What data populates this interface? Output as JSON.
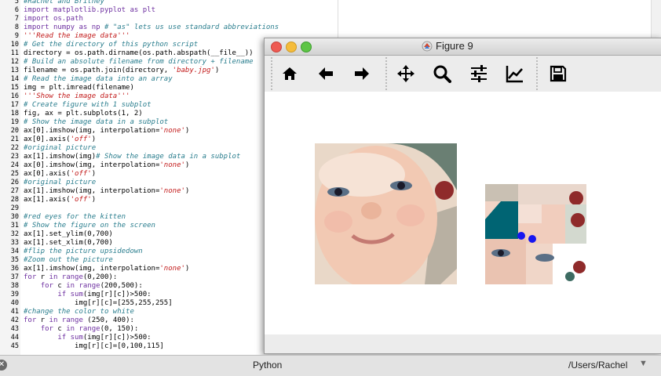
{
  "editor": {
    "lines": [
      {
        "n": "5",
        "segs": [
          [
            "c",
            "#Rachel and Britney"
          ]
        ]
      },
      {
        "n": "6",
        "segs": [
          [
            "k",
            "import"
          ],
          [
            "p",
            " "
          ],
          [
            "k",
            "matplotlib.pyplot"
          ],
          [
            "p",
            " "
          ],
          [
            "k",
            "as"
          ],
          [
            "p",
            " "
          ],
          [
            "k",
            "plt"
          ]
        ]
      },
      {
        "n": "7",
        "segs": [
          [
            "k",
            "import"
          ],
          [
            "p",
            " "
          ],
          [
            "k",
            "os.path"
          ]
        ]
      },
      {
        "n": "8",
        "segs": [
          [
            "k",
            "import"
          ],
          [
            "p",
            " "
          ],
          [
            "k",
            "numpy"
          ],
          [
            "p",
            " "
          ],
          [
            "k",
            "as"
          ],
          [
            "p",
            " "
          ],
          [
            "k",
            "np"
          ],
          [
            "p",
            " "
          ],
          [
            "c",
            "# \"as\" lets us use standard abbreviations"
          ]
        ]
      },
      {
        "n": "9",
        "segs": [
          [
            "s",
            "'''Read the image data'''"
          ]
        ]
      },
      {
        "n": "10",
        "segs": [
          [
            "c",
            "# Get the directory of this python script"
          ]
        ]
      },
      {
        "n": "11",
        "segs": [
          [
            "p",
            "directory = os.path.dirname(os.path.abspath(__file__))"
          ]
        ]
      },
      {
        "n": "12",
        "segs": [
          [
            "c",
            "# Build an absolute filename from directory + filename"
          ]
        ]
      },
      {
        "n": "13",
        "segs": [
          [
            "p",
            "filename = os.path.join(directory, "
          ],
          [
            "s",
            "'baby.jpg'"
          ],
          [
            "p",
            ")"
          ]
        ]
      },
      {
        "n": "14",
        "segs": [
          [
            "c",
            "# Read the image data into an array"
          ]
        ]
      },
      {
        "n": "15",
        "segs": [
          [
            "p",
            "img = plt.imread(filename)"
          ]
        ]
      },
      {
        "n": "16",
        "segs": [
          [
            "s",
            "'''Show the image data'''"
          ]
        ]
      },
      {
        "n": "17",
        "segs": [
          [
            "c",
            "# Create figure with 1 subplot"
          ]
        ]
      },
      {
        "n": "18",
        "segs": [
          [
            "p",
            "fig, ax = plt.subplots(1, 2)"
          ]
        ]
      },
      {
        "n": "19",
        "segs": [
          [
            "c",
            "# Show the image data in a subplot"
          ]
        ]
      },
      {
        "n": "20",
        "segs": [
          [
            "p",
            "ax[0].imshow(img, interpolation="
          ],
          [
            "s",
            "'none'"
          ],
          [
            "p",
            ")"
          ]
        ]
      },
      {
        "n": "21",
        "segs": [
          [
            "p",
            "ax[0].axis("
          ],
          [
            "s",
            "'off'"
          ],
          [
            "p",
            ")"
          ]
        ]
      },
      {
        "n": "22",
        "segs": [
          [
            "c",
            "#original picture"
          ]
        ]
      },
      {
        "n": "23",
        "segs": [
          [
            "p",
            "ax[1].imshow(img)"
          ],
          [
            "c",
            "# Show the image data in a subplot"
          ]
        ]
      },
      {
        "n": "24",
        "segs": [
          [
            "p",
            "ax[0].imshow(img, interpolation="
          ],
          [
            "s",
            "'none'"
          ],
          [
            "p",
            ")"
          ]
        ]
      },
      {
        "n": "25",
        "segs": [
          [
            "p",
            "ax[0].axis("
          ],
          [
            "s",
            "'off'"
          ],
          [
            "p",
            ")"
          ]
        ]
      },
      {
        "n": "26",
        "segs": [
          [
            "c",
            "#original picture"
          ]
        ]
      },
      {
        "n": "27",
        "segs": [
          [
            "p",
            "ax[1].imshow(img, interpolation="
          ],
          [
            "s",
            "'none'"
          ],
          [
            "p",
            ")"
          ]
        ]
      },
      {
        "n": "28",
        "segs": [
          [
            "p",
            "ax[1].axis("
          ],
          [
            "s",
            "'off'"
          ],
          [
            "p",
            ")"
          ]
        ]
      },
      {
        "n": "29",
        "segs": []
      },
      {
        "n": "30",
        "segs": [
          [
            "c",
            "#red eyes for the kitten"
          ]
        ]
      },
      {
        "n": "31",
        "segs": [
          [
            "c",
            "# Show the figure on the screen"
          ]
        ]
      },
      {
        "n": "32",
        "segs": [
          [
            "p",
            "ax[1].set_ylim(0,700)"
          ]
        ]
      },
      {
        "n": "33",
        "segs": [
          [
            "p",
            "ax[1].set_xlim(0,700)"
          ]
        ]
      },
      {
        "n": "34",
        "segs": [
          [
            "c",
            "#flip the picture upsidedown"
          ]
        ]
      },
      {
        "n": "35",
        "segs": [
          [
            "c",
            "#Zoom out the picture"
          ]
        ]
      },
      {
        "n": "36",
        "segs": [
          [
            "p",
            "ax[1].imshow(img, interpolation="
          ],
          [
            "s",
            "'none'"
          ],
          [
            "p",
            ")"
          ]
        ]
      },
      {
        "n": "37",
        "segs": [
          [
            "k",
            "for"
          ],
          [
            "p",
            " r "
          ],
          [
            "k",
            "in"
          ],
          [
            "p",
            " "
          ],
          [
            "k",
            "range"
          ],
          [
            "p",
            "(0,200):"
          ]
        ]
      },
      {
        "n": "38",
        "segs": [
          [
            "p",
            "    "
          ],
          [
            "k",
            "for"
          ],
          [
            "p",
            " c "
          ],
          [
            "k",
            "in"
          ],
          [
            "p",
            " "
          ],
          [
            "k",
            "range"
          ],
          [
            "p",
            "(200,500):"
          ]
        ]
      },
      {
        "n": "39",
        "segs": [
          [
            "p",
            "        "
          ],
          [
            "k",
            "if"
          ],
          [
            "p",
            " "
          ],
          [
            "k",
            "sum"
          ],
          [
            "p",
            "(img[r][c])>500:"
          ]
        ]
      },
      {
        "n": "40",
        "segs": [
          [
            "p",
            "            img[r][c]=[255,255,255]"
          ]
        ]
      },
      {
        "n": "41",
        "segs": [
          [
            "c",
            "#change the color to white"
          ]
        ]
      },
      {
        "n": "42",
        "segs": [
          [
            "k",
            "for"
          ],
          [
            "p",
            " r "
          ],
          [
            "k",
            "in"
          ],
          [
            "p",
            " "
          ],
          [
            "k",
            "range"
          ],
          [
            "p",
            " (250, 400):"
          ]
        ]
      },
      {
        "n": "43",
        "segs": [
          [
            "p",
            "    "
          ],
          [
            "k",
            "for"
          ],
          [
            "p",
            " c "
          ],
          [
            "k",
            "in"
          ],
          [
            "p",
            " "
          ],
          [
            "k",
            "range"
          ],
          [
            "p",
            "(0, 150):"
          ]
        ]
      },
      {
        "n": "44",
        "segs": [
          [
            "p",
            "        "
          ],
          [
            "k",
            "if"
          ],
          [
            "p",
            " "
          ],
          [
            "k",
            "sum"
          ],
          [
            "p",
            "(img[r][c])>500:"
          ]
        ]
      },
      {
        "n": "45",
        "segs": [
          [
            "p",
            "            img[r][c]=[0,100,115]"
          ]
        ]
      }
    ]
  },
  "figure_window": {
    "title": "Figure 9",
    "toolbar": [
      {
        "name": "home",
        "icon": "home-icon"
      },
      {
        "name": "back",
        "icon": "back-arrow-icon"
      },
      {
        "name": "forward",
        "icon": "forward-arrow-icon"
      },
      {
        "name": "pan",
        "icon": "pan-icon"
      },
      {
        "name": "zoom",
        "icon": "zoom-icon"
      },
      {
        "name": "configure-subplots",
        "icon": "sliders-icon"
      },
      {
        "name": "edit-axes",
        "icon": "line-chart-icon"
      },
      {
        "name": "save",
        "icon": "save-icon"
      }
    ]
  },
  "status_bar": {
    "language": "Python",
    "path": "/Users/Rachel"
  },
  "colors": {
    "comment": "#2a7e8e",
    "string": "#c21a1a",
    "keyword": "#6d2fa0",
    "teal_fill": "#006473",
    "eye_blue": "#1616f0"
  }
}
